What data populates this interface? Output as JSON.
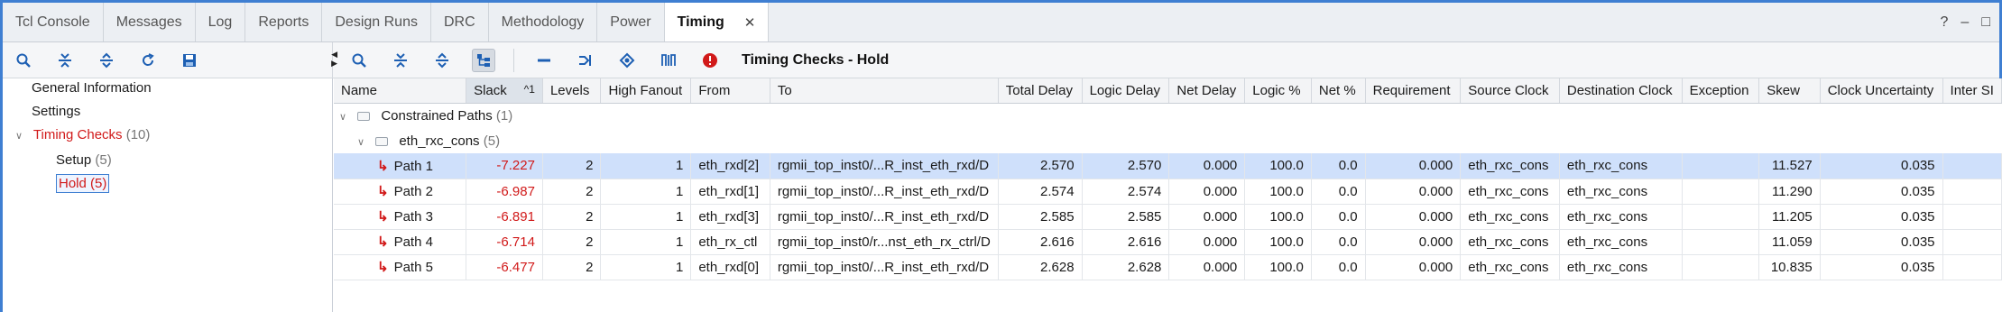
{
  "tabs": [
    {
      "label": "Tcl Console"
    },
    {
      "label": "Messages"
    },
    {
      "label": "Log"
    },
    {
      "label": "Reports"
    },
    {
      "label": "Design Runs"
    },
    {
      "label": "DRC"
    },
    {
      "label": "Methodology"
    },
    {
      "label": "Power"
    },
    {
      "label": "Timing",
      "active": true
    }
  ],
  "tabbar_right": {
    "help": "?",
    "minimize": "–",
    "maximize": "□"
  },
  "toolbar": {
    "title": "Timing Checks - Hold"
  },
  "tree": {
    "general": "General Information",
    "settings": "Settings",
    "timing_checks": {
      "label": "Timing Checks",
      "count": "(10)"
    },
    "setup": {
      "label": "Setup",
      "count": "(5)"
    },
    "hold": {
      "label": "Hold (5)"
    }
  },
  "columns": [
    "Name",
    "Slack",
    "Levels",
    "High Fanout",
    "From",
    "To",
    "Total Delay",
    "Logic Delay",
    "Net Delay",
    "Logic %",
    "Net %",
    "Requirement",
    "Source Clock",
    "Destination Clock",
    "Exception",
    "Skew",
    "Clock Uncertainty",
    "Inter SI"
  ],
  "sort_indicator": "^1",
  "groups": {
    "constrained": {
      "label": "Constrained Paths",
      "count": "(1)"
    },
    "clock_group": {
      "label": "eth_rxc_cons",
      "count": "(5)"
    }
  },
  "rows": [
    {
      "name": "Path 1",
      "slack": "-7.227",
      "levels": "2",
      "fanout": "1",
      "from": "eth_rxd[2]",
      "to": "rgmii_top_inst0/...R_inst_eth_rxd/D",
      "total": "2.570",
      "logic": "2.570",
      "net": "0.000",
      "logic_pct": "100.0",
      "net_pct": "0.0",
      "req": "0.000",
      "src": "eth_rxc_cons",
      "dst": "eth_rxc_cons",
      "exc": "",
      "skew": "11.527",
      "unc": "0.035"
    },
    {
      "name": "Path 2",
      "slack": "-6.987",
      "levels": "2",
      "fanout": "1",
      "from": "eth_rxd[1]",
      "to": "rgmii_top_inst0/...R_inst_eth_rxd/D",
      "total": "2.574",
      "logic": "2.574",
      "net": "0.000",
      "logic_pct": "100.0",
      "net_pct": "0.0",
      "req": "0.000",
      "src": "eth_rxc_cons",
      "dst": "eth_rxc_cons",
      "exc": "",
      "skew": "11.290",
      "unc": "0.035"
    },
    {
      "name": "Path 3",
      "slack": "-6.891",
      "levels": "2",
      "fanout": "1",
      "from": "eth_rxd[3]",
      "to": "rgmii_top_inst0/...R_inst_eth_rxd/D",
      "total": "2.585",
      "logic": "2.585",
      "net": "0.000",
      "logic_pct": "100.0",
      "net_pct": "0.0",
      "req": "0.000",
      "src": "eth_rxc_cons",
      "dst": "eth_rxc_cons",
      "exc": "",
      "skew": "11.205",
      "unc": "0.035"
    },
    {
      "name": "Path 4",
      "slack": "-6.714",
      "levels": "2",
      "fanout": "1",
      "from": "eth_rx_ctl",
      "to": "rgmii_top_inst0/r...nst_eth_rx_ctrl/D",
      "total": "2.616",
      "logic": "2.616",
      "net": "0.000",
      "logic_pct": "100.0",
      "net_pct": "0.0",
      "req": "0.000",
      "src": "eth_rxc_cons",
      "dst": "eth_rxc_cons",
      "exc": "",
      "skew": "11.059",
      "unc": "0.035"
    },
    {
      "name": "Path 5",
      "slack": "-6.477",
      "levels": "2",
      "fanout": "1",
      "from": "eth_rxd[0]",
      "to": "rgmii_top_inst0/...R_inst_eth_rxd/D",
      "total": "2.628",
      "logic": "2.628",
      "net": "0.000",
      "logic_pct": "100.0",
      "net_pct": "0.0",
      "req": "0.000",
      "src": "eth_rxc_cons",
      "dst": "eth_rxc_cons",
      "exc": "",
      "skew": "10.835",
      "unc": "0.035"
    }
  ],
  "colors": {
    "accent": "#3f7fd2",
    "negative": "#d11a1a",
    "selected_row": "#cfe0fb"
  }
}
